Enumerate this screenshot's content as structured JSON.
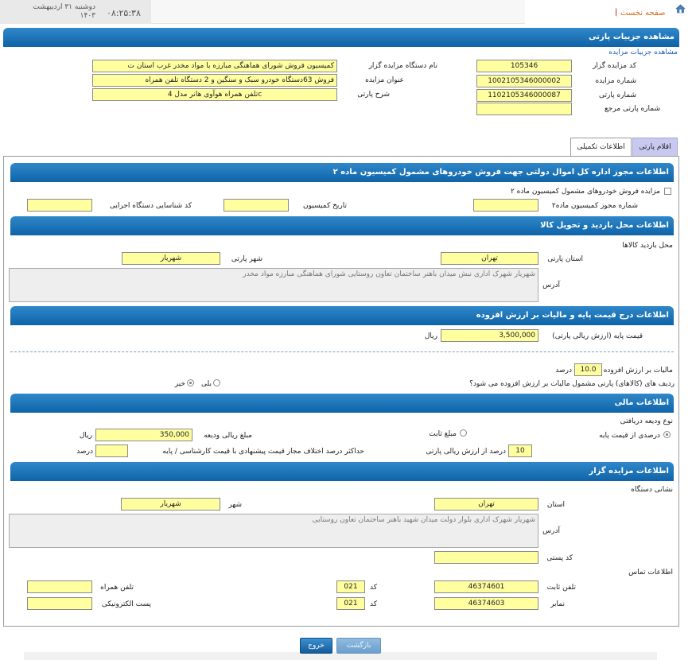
{
  "topbar": {
    "home_link": "صفحه نخست",
    "separator": "|",
    "time": "۰۸:۲۵:۳۸",
    "date_line1": "دوشنبه ۳۱ اردیبهشت",
    "date_line2": "۱۴۰۳"
  },
  "page": {
    "title": "مشاهده جزییات پارتی",
    "breadcrumb": "مشاهده جزییات مزایده"
  },
  "general": {
    "auctioneer_code_label": "کد مزایده گزار",
    "auctioneer_code": "105346",
    "auction_number_label": "شماره مزایده",
    "auction_number": "1002105346000002",
    "party_number_label": "شماره پارتی",
    "party_number": "1102105346000087",
    "ref_party_number_label": "شماره پارتی مرجع",
    "ref_party_number": "",
    "device_name_label": "نام دستگاه مزایده گزار",
    "device_name": "کمیسیون فروش شورای هماهنگی مبارزه با مواد مخدر غرب استان ت",
    "auction_title_label": "عنوان مزایده",
    "auction_title": "فروش 63دستگاه خودرو سبک و سنگین و 2 دستگاه تلفن همراه",
    "party_desc_label": "شرح پارتی",
    "party_desc": "تلفن همراه هوآوی هانر مدل 4c"
  },
  "tabs": {
    "items_tab": "اقلام پارتی",
    "extra_tab": "اطلاعات تکمیلی"
  },
  "sec_permit": {
    "title": "اطلاعات مجوز اداره کل اموال دولتی جهت فروش خودروهای مشمول کمیسیون ماده ۲",
    "checkbox_label": "مزایده فروش خودروهای مشمول کمیسیون ماده ۲",
    "permit_no_label": "شماره مجوز کمیسیون ماده۲",
    "permit_no": "",
    "commission_date_label": "تاریخ کمیسیون",
    "commission_date": "",
    "exec_code_label": "کد شناسایی دستگاه اجرایی",
    "exec_code": ""
  },
  "sec_visit": {
    "title": "اطلاعات محل بازدید و تحویل کالا",
    "subtitle": "محل بازدید کالاها",
    "province_label": "استان پارتی",
    "province": "تهران",
    "city_label": "شهر پارتی",
    "city": "شهریار",
    "address_label": "آدرس",
    "address": "شهریار شهرک اداری نبش میدان باهنر ساختمان تعاون روستایی شورای هماهنگی مبارزه مواد مخدر"
  },
  "sec_price": {
    "title": "اطلاعات درج قیمت پایه و مالیات بر ارزش افزوده",
    "base_price_label": "قیمت پایه (ارزش ریالی پارتی)",
    "base_price": "3,500,000",
    "currency": "ریال",
    "vat_label": "مالیات بر ارزش افزوده",
    "vat": "10.0",
    "percent": "درصد",
    "vat_question": "ردیف های (کالاهای) پارتی مشمول مالیات بر ارزش افزوده می شود؟",
    "yes": "بلی",
    "no": "خیر"
  },
  "sec_finance": {
    "title": "اطلاعات مالی",
    "deposit_type_label": "نوع ودیعه دریافتی",
    "percent_of_base": "درصدی از قیمت پایه",
    "fixed_amount": "مبلغ ثابت",
    "deposit_amount_label": "مبلغ ریالی ودیعه",
    "deposit_amount": "350,000",
    "currency": "ریال",
    "deposit_percent": "10",
    "deposit_percent_label": "درصد از ارزش ریالی پارتی",
    "max_diff_label": "حداکثر درصد اختلاف مجاز قیمت پیشنهادی با قیمت کارشناسی / پایه",
    "max_diff": "",
    "percent": "درصد"
  },
  "sec_auctioneer": {
    "title": "اطلاعات مزایده گزار",
    "device_address_label": "نشانی دستگاه",
    "province_label": "استان",
    "province": "تهران",
    "city_label": "شهر",
    "city": "شهریار",
    "address_label": "آدرس",
    "address": "شهریار شهرک اداری بلوار دولت میدان شهید باهنر ساختمان تعاون روستایی",
    "postal_label": "کد پستی",
    "postal": "",
    "contact_label": "اطلاعات تماس",
    "phone_label": "تلفن ثابت",
    "phone": "46374601",
    "phone_code_label": "کد",
    "phone_code": "021",
    "fax_label": "نمابر",
    "fax": "46374603",
    "fax_code_label": "کد",
    "fax_code": "021",
    "mobile_label": "تلفن همراه",
    "mobile": "",
    "email_label": "پست الکترونیکی",
    "email": ""
  },
  "buttons": {
    "back": "بازگشت",
    "exit": "خروج"
  },
  "colors": {
    "header_blue": "#1a6fb5",
    "field_yellow": "#ffffa0"
  }
}
